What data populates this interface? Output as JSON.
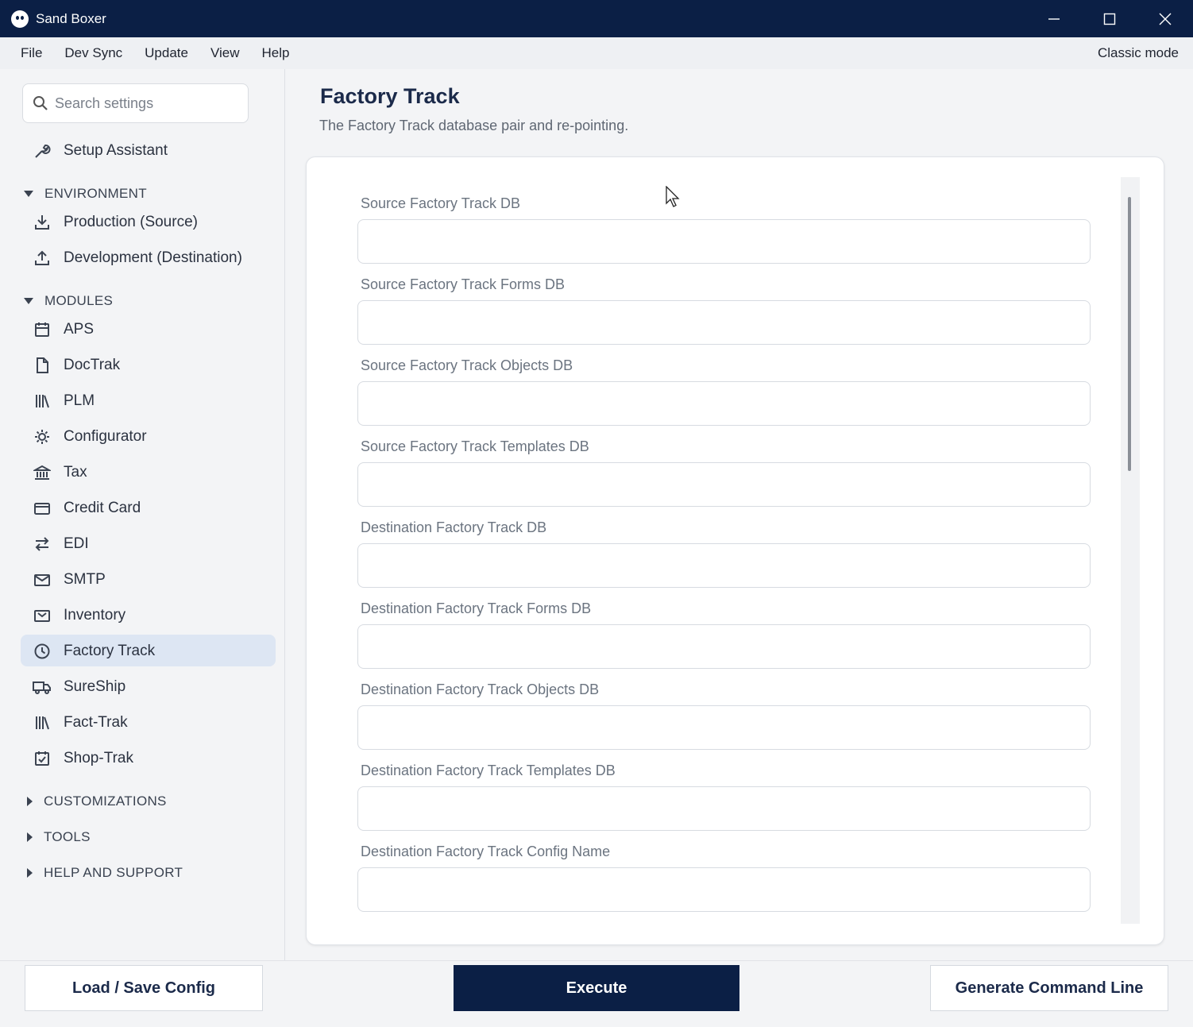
{
  "window": {
    "title": "Sand Boxer"
  },
  "menu": {
    "items": [
      "File",
      "Dev Sync",
      "Update",
      "View",
      "Help"
    ],
    "mode_label": "Classic mode"
  },
  "sidebar": {
    "search_placeholder": "Search settings",
    "setup_assistant": "Setup Assistant",
    "environment": {
      "label": "ENVIRONMENT",
      "items": [
        "Production (Source)",
        "Development (Destination)"
      ]
    },
    "modules": {
      "label": "MODULES",
      "items": [
        "APS",
        "DocTrak",
        "PLM",
        "Configurator",
        "Tax",
        "Credit Card",
        "EDI",
        "SMTP",
        "Inventory",
        "Factory Track",
        "SureShip",
        "Fact-Trak",
        "Shop-Trak"
      ],
      "active": "Factory Track"
    },
    "collapsed_sections": [
      "CUSTOMIZATIONS",
      "TOOLS",
      "HELP AND SUPPORT"
    ]
  },
  "main": {
    "title": "Factory Track",
    "subtitle": "The Factory Track database pair and re-pointing.",
    "fields": [
      {
        "label": "Source Factory Track DB",
        "value": ""
      },
      {
        "label": "Source Factory Track Forms DB",
        "value": ""
      },
      {
        "label": "Source Factory Track Objects DB",
        "value": ""
      },
      {
        "label": "Source Factory Track Templates DB",
        "value": ""
      },
      {
        "label": "Destination Factory Track DB",
        "value": ""
      },
      {
        "label": "Destination Factory Track Forms DB",
        "value": ""
      },
      {
        "label": "Destination Factory Track Objects DB",
        "value": ""
      },
      {
        "label": "Destination Factory Track Templates DB",
        "value": ""
      },
      {
        "label": "Destination Factory Track Config Name",
        "value": ""
      }
    ]
  },
  "footer": {
    "load_save": "Load / Save Config",
    "execute": "Execute",
    "generate": "Generate Command Line"
  },
  "colors": {
    "navy": "#0b1f45",
    "active_bg": "#dde6f3"
  }
}
